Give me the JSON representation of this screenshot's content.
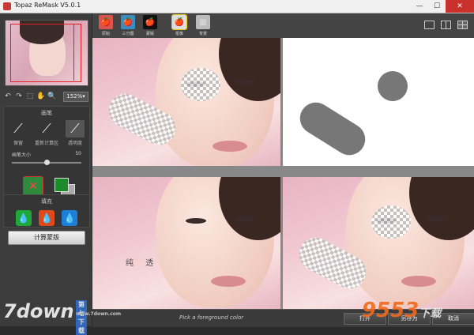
{
  "window": {
    "title": "Topaz ReMask V5.0.1",
    "minimize": "—",
    "maximize": "☐",
    "close": "✕"
  },
  "toolbar": {
    "zoom": "152%▾"
  },
  "brush_panel": {
    "title": "画笔",
    "brushes": [
      "保留",
      "重新计算区",
      "透明度"
    ],
    "size_label": "画笔大小",
    "size_value": "50",
    "size_level": 0.5
  },
  "fill_panel": {
    "title": "填充"
  },
  "compute_button": "计算蒙版",
  "view_tabs": [
    "原始",
    "三分图",
    "蒙版",
    "抠像",
    "背景"
  ],
  "canvas": {
    "overlay_text": "纯 透"
  },
  "status": {
    "hint": "Pick a foreground color",
    "open": "打开",
    "save_as": "另存为",
    "cancel": "取消"
  },
  "watermark": {
    "left_logo": "7down",
    "left_sub": "第七下载",
    "left_url": "www.7down.com",
    "right_logo": "9553",
    "right_sub": "下载"
  },
  "colors": {
    "foreground": "#1c8a2a",
    "background": "#aaaaaa",
    "fill_green": "#1fa83a",
    "fill_red": "#e04a1a",
    "fill_blue": "#1e7fd8"
  }
}
